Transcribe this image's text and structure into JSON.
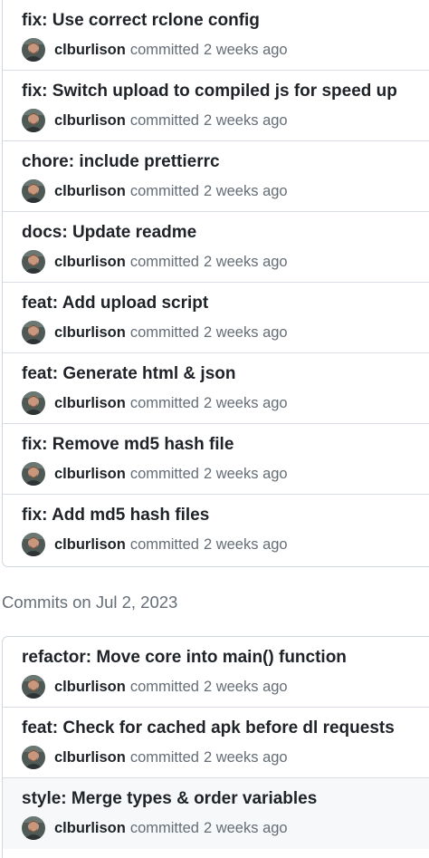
{
  "group1": {
    "commits": [
      {
        "message": "fix: Use correct rclone config",
        "author": "clburlison",
        "verb": "committed",
        "time": "2 weeks ago"
      },
      {
        "message": "fix: Switch upload to compiled js for speed up",
        "author": "clburlison",
        "verb": "committed",
        "time": "2 weeks ago"
      },
      {
        "message": "chore: include prettierrc",
        "author": "clburlison",
        "verb": "committed",
        "time": "2 weeks ago"
      },
      {
        "message": "docs: Update readme",
        "author": "clburlison",
        "verb": "committed",
        "time": "2 weeks ago"
      },
      {
        "message": "feat: Add upload script",
        "author": "clburlison",
        "verb": "committed",
        "time": "2 weeks ago"
      },
      {
        "message": "feat: Generate html & json",
        "author": "clburlison",
        "verb": "committed",
        "time": "2 weeks ago"
      },
      {
        "message": "fix: Remove md5 hash file",
        "author": "clburlison",
        "verb": "committed",
        "time": "2 weeks ago"
      },
      {
        "message": "fix: Add md5 hash files",
        "author": "clburlison",
        "verb": "committed",
        "time": "2 weeks ago"
      }
    ]
  },
  "group2": {
    "date_header": "Commits on Jul 2, 2023",
    "commits": [
      {
        "message": "refactor: Move core into main() function",
        "author": "clburlison",
        "verb": "committed",
        "time": "2 weeks ago"
      },
      {
        "message": "feat: Check for cached apk before dl requests",
        "author": "clburlison",
        "verb": "committed",
        "time": "2 weeks ago"
      },
      {
        "message": "style: Merge types & order variables",
        "author": "clburlison",
        "verb": "committed",
        "time": "2 weeks ago"
      }
    ]
  },
  "colors": {
    "border": "#d0d7de",
    "muted_text": "#656d76",
    "primary_text": "#1f2328",
    "hover_row_bg": "#f6f8fa"
  }
}
